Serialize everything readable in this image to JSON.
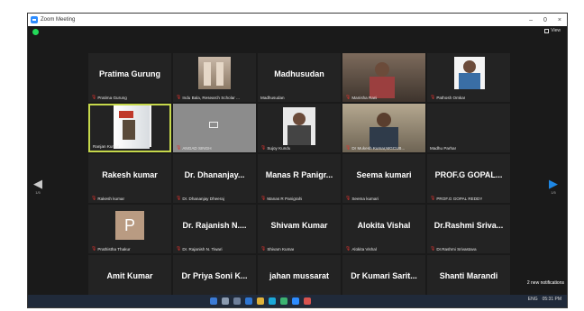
{
  "window": {
    "title": "Zoom Meeting",
    "minimize": "–",
    "maximize": "0",
    "close": "×"
  },
  "view_button": {
    "label": "View"
  },
  "gallery": {
    "prev_page": {
      "arrow": "◀",
      "page": "1/5"
    },
    "next_page": {
      "arrow": "▶",
      "page": "1/5"
    },
    "tiles": [
      {
        "display": "Pratima Gurung",
        "label": "Pratima Gurung",
        "muted": true
      },
      {
        "display": "",
        "label": "Indu Bala, Research Scholar ...",
        "muted": true
      },
      {
        "display": "Madhusudan",
        "label": "Madhusudan",
        "muted": false
      },
      {
        "display": "",
        "label": "Manisha Rani",
        "muted": true
      },
      {
        "display": "",
        "label": "Pathosh Omkar",
        "muted": true
      },
      {
        "display": "",
        "label": "Ranjan Kumar",
        "muted": false
      },
      {
        "display": "",
        "label": "ANGAD SINGH",
        "muted": true
      },
      {
        "display": "",
        "label": "Sujoy Kundu",
        "muted": true
      },
      {
        "display": "",
        "label": "Dr Mukesh Kumar,MGCUB...",
        "muted": true
      },
      {
        "display": "",
        "label": "Madhu Parhar",
        "muted": false
      },
      {
        "display": "Rakesh kumar",
        "label": "Rakesh kumar",
        "muted": true
      },
      {
        "display": "Dr. Dhananjay...",
        "label": "Dr. Dhananjay Dheeraj",
        "muted": true
      },
      {
        "display": "Manas R Panigr...",
        "label": "Manas R Panigrahi",
        "muted": true
      },
      {
        "display": "Seema kumari",
        "label": "Seema kumari",
        "muted": true
      },
      {
        "display": "PROF.G GOPAL...",
        "label": "PROF.G GOPAL REDDY",
        "muted": true
      },
      {
        "display": "",
        "avatar": "P",
        "label": "Prathistha Thakur",
        "muted": true
      },
      {
        "display": "Dr. Rajanish N....",
        "label": "Dr. Rajanish N. Tiwari",
        "muted": true
      },
      {
        "display": "Shivam Kumar",
        "label": "Shivam Kumar",
        "muted": true
      },
      {
        "display": "Alokita Vishal",
        "label": "Alokita Vishal",
        "muted": true
      },
      {
        "display": "Dr.Rashmi Sriva...",
        "label": "Dr.Rashmi Srivastava",
        "muted": true
      },
      {
        "display": "Amit Kumar",
        "label": "Amit Kumar",
        "muted": true
      },
      {
        "display": "Dr Priya Soni K...",
        "label": "Dr Priya Soni Khare",
        "muted": true
      },
      {
        "display": "jahan mussarat",
        "label": "jahan mussarat",
        "muted": true
      },
      {
        "display": "Dr Kumari Sarit...",
        "label": "Dr Kumari Sarita JBMA Colle...",
        "muted": true
      },
      {
        "display": "Shanti Marandi",
        "label": "Shanti Marandi",
        "muted": true
      }
    ]
  },
  "notifications": {
    "label": "2 new notifications"
  },
  "taskbar": {
    "lang": "ENG",
    "time": "05:31 PM"
  },
  "colors": {
    "accent": "#2d8cff",
    "active_speaker": "#c6d84b",
    "mic_muted": "#e0332f",
    "background": "#1a1a1a"
  }
}
